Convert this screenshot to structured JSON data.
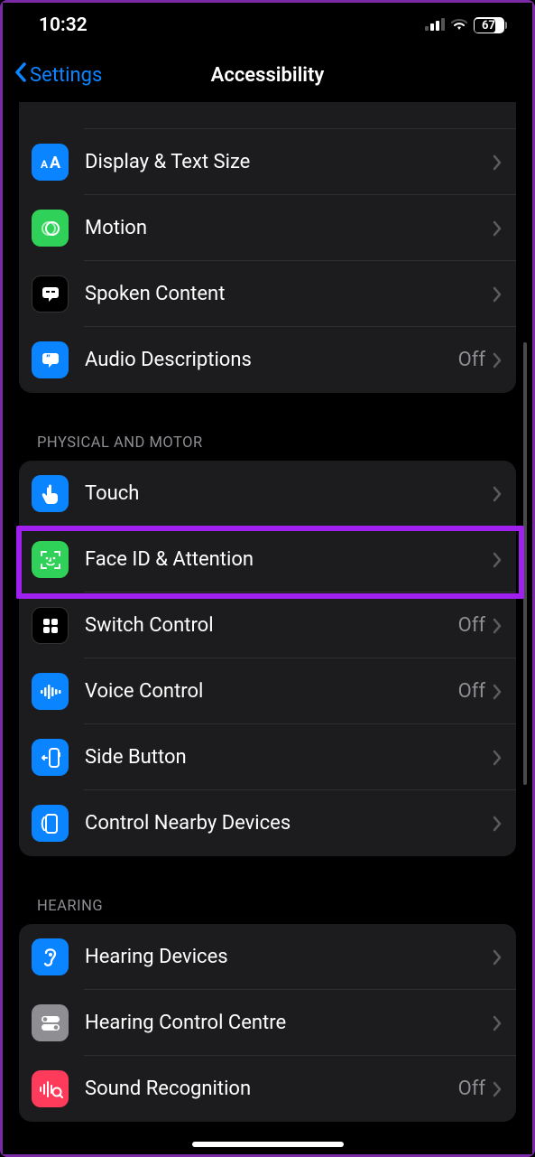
{
  "status_bar": {
    "time": "10:32",
    "battery": "67"
  },
  "nav": {
    "back_label": "Settings",
    "title": "Accessibility"
  },
  "sections": {
    "vision_extra": [
      {
        "id": "display-text-size",
        "label": "Display & Text Size",
        "value": null,
        "icon_bg": "#0b84ff",
        "icon": "aA"
      },
      {
        "id": "motion",
        "label": "Motion",
        "value": null,
        "icon_bg": "#30d158",
        "icon": "motion"
      },
      {
        "id": "spoken-content",
        "label": "Spoken Content",
        "value": null,
        "icon_bg": "#000",
        "icon": "speech"
      },
      {
        "id": "audio-descriptions",
        "label": "Audio Descriptions",
        "value": "Off",
        "icon_bg": "#0b84ff",
        "icon": "quote"
      }
    ],
    "physical_header": "Physical and Motor",
    "physical": [
      {
        "id": "touch",
        "label": "Touch",
        "value": null,
        "icon_bg": "#0b84ff",
        "icon": "pointer"
      },
      {
        "id": "faceid-attention",
        "label": "Face ID & Attention",
        "value": null,
        "icon_bg": "#30d158",
        "icon": "faceid",
        "highlight": true
      },
      {
        "id": "switch-control",
        "label": "Switch Control",
        "value": "Off",
        "icon_bg": "#000",
        "icon": "grid"
      },
      {
        "id": "voice-control",
        "label": "Voice Control",
        "value": "Off",
        "icon_bg": "#0b84ff",
        "icon": "wave"
      },
      {
        "id": "side-button",
        "label": "Side Button",
        "value": null,
        "icon_bg": "#0b84ff",
        "icon": "side"
      },
      {
        "id": "control-nearby",
        "label": "Control Nearby Devices",
        "value": null,
        "icon_bg": "#0b84ff",
        "icon": "nearby"
      }
    ],
    "hearing_header": "Hearing",
    "hearing": [
      {
        "id": "hearing-devices",
        "label": "Hearing Devices",
        "value": null,
        "icon_bg": "#0b84ff",
        "icon": "ear"
      },
      {
        "id": "hearing-control-centre",
        "label": "Hearing Control Centre",
        "value": null,
        "icon_bg": "#8e8e93",
        "icon": "toggle"
      },
      {
        "id": "sound-recognition",
        "label": "Sound Recognition",
        "value": "Off",
        "icon_bg": "#ff3b5c",
        "icon": "soundrec"
      }
    ]
  }
}
